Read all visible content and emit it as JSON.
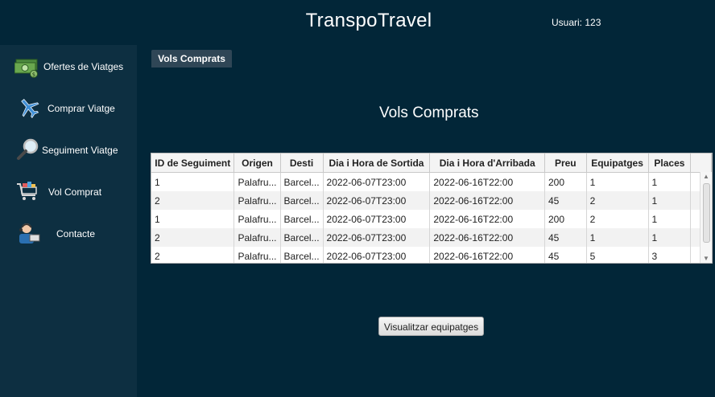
{
  "header": {
    "title": "TranspoTravel",
    "user": "Usuari: 123"
  },
  "sidebar": {
    "items": [
      {
        "label": "Ofertes de Viatges",
        "icon": "money-icon"
      },
      {
        "label": "Comprar Viatge",
        "icon": "airplane-icon"
      },
      {
        "label": "Seguiment Viatge",
        "icon": "magnifier-icon"
      },
      {
        "label": "Vol Comprat",
        "icon": "shopping-cart-icon"
      },
      {
        "label": "Contacte",
        "icon": "support-agent-icon"
      }
    ]
  },
  "main": {
    "tab": "Vols Comprats",
    "heading": "Vols Comprats",
    "table": {
      "columns": [
        "ID de Seguiment",
        "Origen",
        "Desti",
        "Dia i Hora de Sortida",
        "Dia i Hora d'Arribada",
        "Preu",
        "Equipatges",
        "Places"
      ],
      "rows": [
        [
          "1",
          "Palafru...",
          "Barcel...",
          "2022-06-07T23:00",
          "2022-06-16T22:00",
          "200",
          "1",
          "1"
        ],
        [
          "2",
          "Palafru...",
          "Barcel...",
          "2022-06-07T23:00",
          "2022-06-16T22:00",
          "45",
          "2",
          "1"
        ],
        [
          "1",
          "Palafru...",
          "Barcel...",
          "2022-06-07T23:00",
          "2022-06-16T22:00",
          "200",
          "2",
          "1"
        ],
        [
          "2",
          "Palafru...",
          "Barcel...",
          "2022-06-07T23:00",
          "2022-06-16T22:00",
          "45",
          "1",
          "1"
        ],
        [
          "2",
          "Palafru...",
          "Barcel...",
          "2022-06-07T23:00",
          "2022-06-16T22:00",
          "45",
          "5",
          "3"
        ]
      ]
    },
    "button": "Visualitzar equipatges"
  }
}
